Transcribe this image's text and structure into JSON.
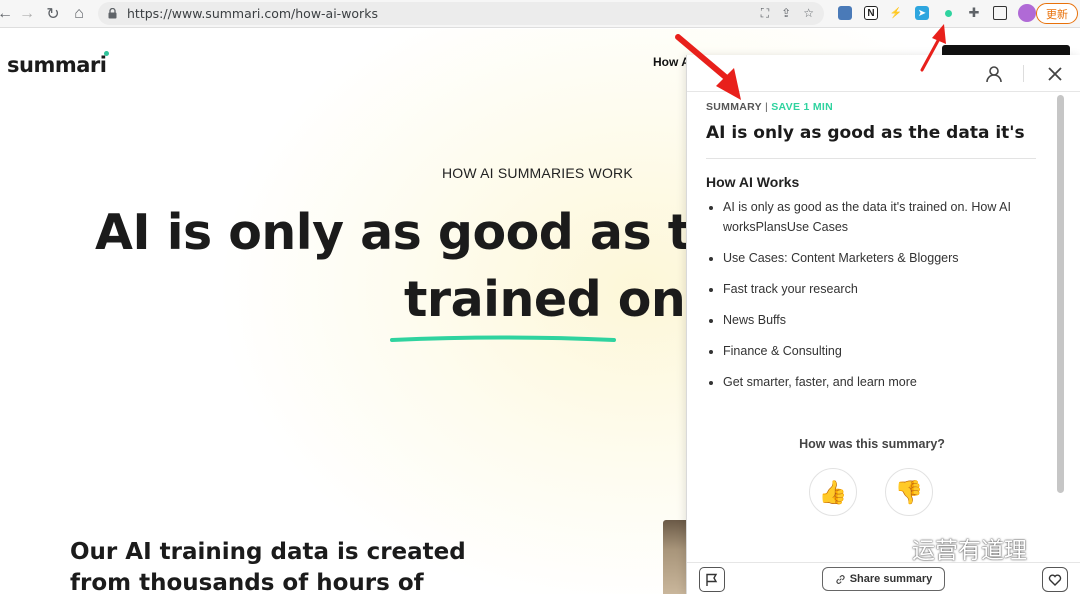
{
  "browser": {
    "url": "https://www.summari.com/how-ai-works",
    "update_label": "更新"
  },
  "site": {
    "logo": "summari",
    "nav_item": "How A",
    "eyebrow": "HOW AI SUMMARIES WORK",
    "headline_line1": "AI is only as good as th",
    "headline_line2": "trained on",
    "subhead": "Our AI training data is created from thousands of hours of"
  },
  "panel": {
    "summary_label": "SUMMARY",
    "separator": "|",
    "save_label": "SAVE 1 MIN",
    "title": "AI is only as good as the data it's",
    "section_title": "How AI Works",
    "bullets": [
      "AI is only as good as the data it's trained on. How AI worksPlansUse Cases",
      "Use Cases: Content Marketers & Bloggers",
      "Fast track your research",
      "News Buffs",
      "Finance & Consulting",
      "Get smarter, faster, and learn more"
    ],
    "feedback_question": "How was this summary?",
    "thumbs_up": "👍",
    "thumbs_down": "👎",
    "share_label": "Share summary"
  },
  "watermark": "运营有道理",
  "colors": {
    "accent_green": "#2fd39f",
    "arrow_red": "#e8201b",
    "update_orange": "#e8710a"
  }
}
